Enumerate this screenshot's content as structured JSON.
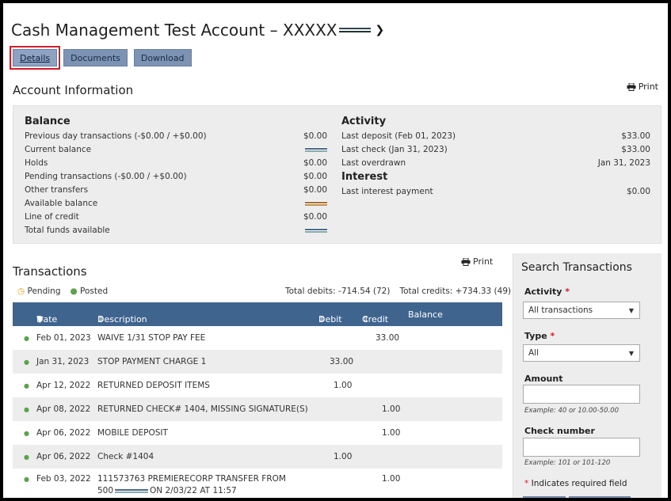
{
  "header": {
    "title": "Cash Management Test Account – XXXXX"
  },
  "tabs": [
    {
      "label": "Details"
    },
    {
      "label": "Documents"
    },
    {
      "label": "Download"
    }
  ],
  "account_info": {
    "heading": "Account Information",
    "print_label": "Print",
    "balance": {
      "heading": "Balance",
      "rows": [
        {
          "label": "Previous day transactions (-$0.00 / +$0.00)",
          "value": "$0.00"
        },
        {
          "label": "Current balance",
          "value": ""
        },
        {
          "label": "Holds",
          "value": "$0.00"
        },
        {
          "label": "Pending transactions (-$0.00 / +$0.00)",
          "value": "$0.00"
        },
        {
          "label": "Other transfers",
          "value": "$0.00"
        },
        {
          "label": "Available balance",
          "value": ""
        },
        {
          "label": "Line of credit",
          "value": "$0.00"
        },
        {
          "label": "Total funds available",
          "value": ""
        }
      ]
    },
    "activity": {
      "heading": "Activity",
      "rows": [
        {
          "label": "Last deposit (Feb 01, 2023)",
          "value": "$33.00"
        },
        {
          "label": "Last check (Jan 31, 2023)",
          "value": "$33.00"
        },
        {
          "label": "Last overdrawn",
          "value": "Jan 31, 2023"
        }
      ]
    },
    "interest": {
      "heading": "Interest",
      "rows": [
        {
          "label": "Last interest payment",
          "value": "$0.00"
        }
      ]
    }
  },
  "transactions": {
    "heading": "Transactions",
    "print_label": "Print",
    "legend_pending": "Pending",
    "legend_posted": "Posted",
    "total_debits": "Total debits: -714.54 (72)",
    "total_credits": "Total credits: +734.33 (49)",
    "columns": {
      "date": "Date",
      "description": "Description",
      "debit": "Debit",
      "credit": "Credit",
      "balance": "Balance"
    },
    "rows": [
      {
        "date": "Feb 01, 2023",
        "description": "WAIVE 1/31 STOP PAY FEE",
        "debit": "",
        "credit": "33.00"
      },
      {
        "date": "Jan 31, 2023",
        "description": "STOP PAYMENT CHARGE 1",
        "debit": "33.00",
        "credit": ""
      },
      {
        "date": "Apr 12, 2022",
        "description": "RETURNED DEPOSIT ITEMS",
        "debit": "1.00",
        "credit": ""
      },
      {
        "date": "Apr 08, 2022",
        "description": "RETURNED CHECK# 1404, MISSING SIGNATURE(S)",
        "debit": "",
        "credit": "1.00"
      },
      {
        "date": "Apr 06, 2022",
        "description": "MOBILE DEPOSIT",
        "debit": "",
        "credit": "1.00"
      },
      {
        "date": "Apr 06, 2022",
        "description": "Check #1404",
        "debit": "1.00",
        "credit": ""
      },
      {
        "date": "Feb 03, 2022",
        "description": "111573763 PREMIERECORP TRANSFER FROM",
        "description2a": "500",
        "description2b": "ON 2/03/22 AT 11:57",
        "debit": "",
        "credit": "1.00"
      }
    ]
  },
  "search": {
    "heading": "Search Transactions",
    "activity_label": "Activity",
    "activity_value": "All transactions",
    "type_label": "Type",
    "type_value": "All",
    "amount_label": "Amount",
    "amount_hint": "Example: 40 or 10.00-50.00",
    "check_label": "Check number",
    "check_hint": "Example: 101 or 101-120",
    "required_note": "Indicates required field"
  }
}
